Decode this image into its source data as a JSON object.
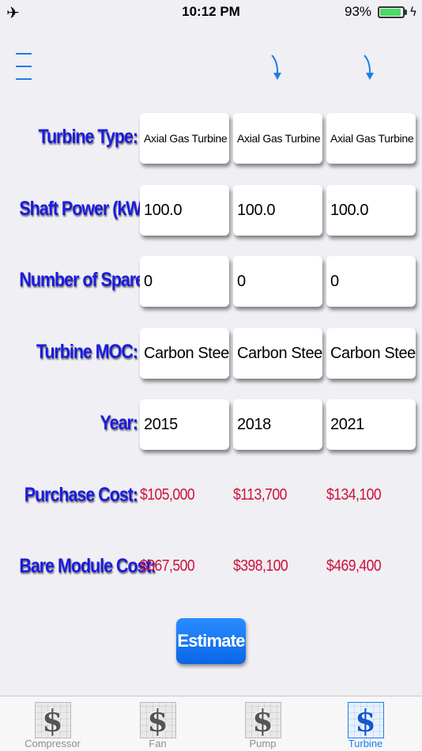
{
  "status_bar": {
    "time": "10:12 PM",
    "battery_percent": "93%",
    "battery_level": 0.93,
    "airplane_icon": "airplane-icon",
    "charging_icon": "bolt-icon"
  },
  "toolbar": {
    "menu_icon": "hamburger-menu-icon",
    "arrow_icon": "curved-down-arrow-icon"
  },
  "rows": {
    "turbine_type": {
      "label": "Turbine Type:",
      "values": [
        "Axial Gas Turbine",
        "Axial Gas Turbine",
        "Axial Gas Turbine"
      ]
    },
    "shaft_power": {
      "label": "Shaft Power (kW):",
      "values": [
        "100.0",
        "100.0",
        "100.0"
      ]
    },
    "number_of_spares": {
      "label": "Number of Spares:",
      "values": [
        "0",
        "0",
        "0"
      ]
    },
    "turbine_moc": {
      "label": "Turbine MOC:",
      "values": [
        "Carbon Steel",
        "Carbon Steel",
        "Carbon Steel"
      ]
    },
    "year": {
      "label": "Year:",
      "values": [
        "2015",
        "2018",
        "2021"
      ]
    },
    "purchase_cost": {
      "label": "Purchase Cost:",
      "values": [
        "$105,000",
        "$113,700",
        "$134,100"
      ]
    },
    "bare_module_cost": {
      "label": "Bare Module Cost:",
      "values": [
        "$367,500",
        "$398,100",
        "$469,400"
      ]
    }
  },
  "estimate_button": {
    "label": "Estimate"
  },
  "tabs": [
    {
      "label": "Compressor",
      "icon": "dollar-icon",
      "active": false
    },
    {
      "label": "Fan",
      "icon": "dollar-icon",
      "active": false
    },
    {
      "label": "Pump",
      "icon": "dollar-icon",
      "active": false
    },
    {
      "label": "Turbine",
      "icon": "dollar-icon",
      "active": true
    }
  ],
  "colors": {
    "label_blue": "#1a1ae0",
    "cost_red": "#d0103a",
    "accent": "#1a7cf5",
    "battery_green": "#4cd964"
  }
}
